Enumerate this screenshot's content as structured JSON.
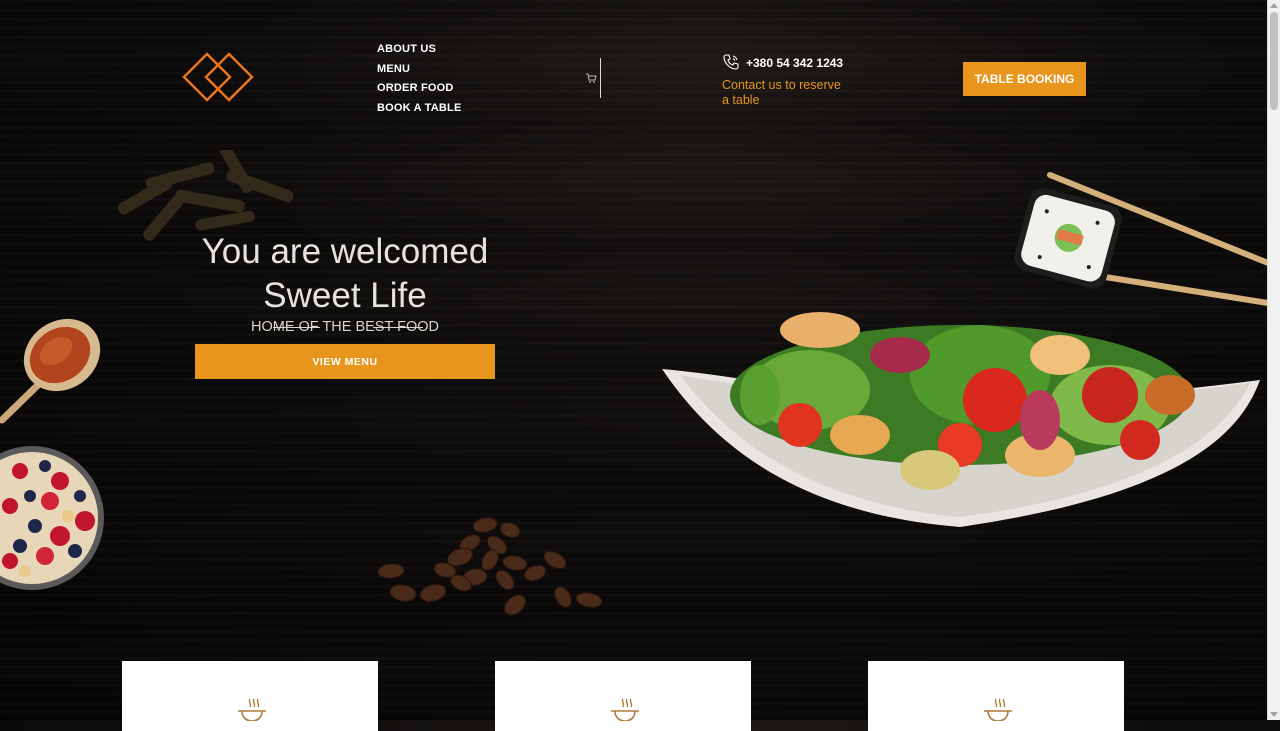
{
  "nav": {
    "items": [
      {
        "label": "ABOUT US"
      },
      {
        "label": "MENU"
      },
      {
        "label": "ORDER FOOD"
      },
      {
        "label": "BOOK A TABLE"
      }
    ]
  },
  "contact": {
    "phone": "+380 54 342 1243",
    "text": "Contact us to reserve a table"
  },
  "header": {
    "booking_label": "TABLE BOOKING"
  },
  "hero": {
    "line1": "You are welcomed",
    "line2": "Sweet Life",
    "tagline": "HOME OF THE BEST FOOD",
    "button_label": "VIEW MENU"
  },
  "colors": {
    "accent": "#e8951d",
    "background": "#0f0d0c"
  },
  "icons": [
    "logo-diamonds-icon",
    "cart-icon",
    "phone-icon",
    "cup-icon"
  ]
}
